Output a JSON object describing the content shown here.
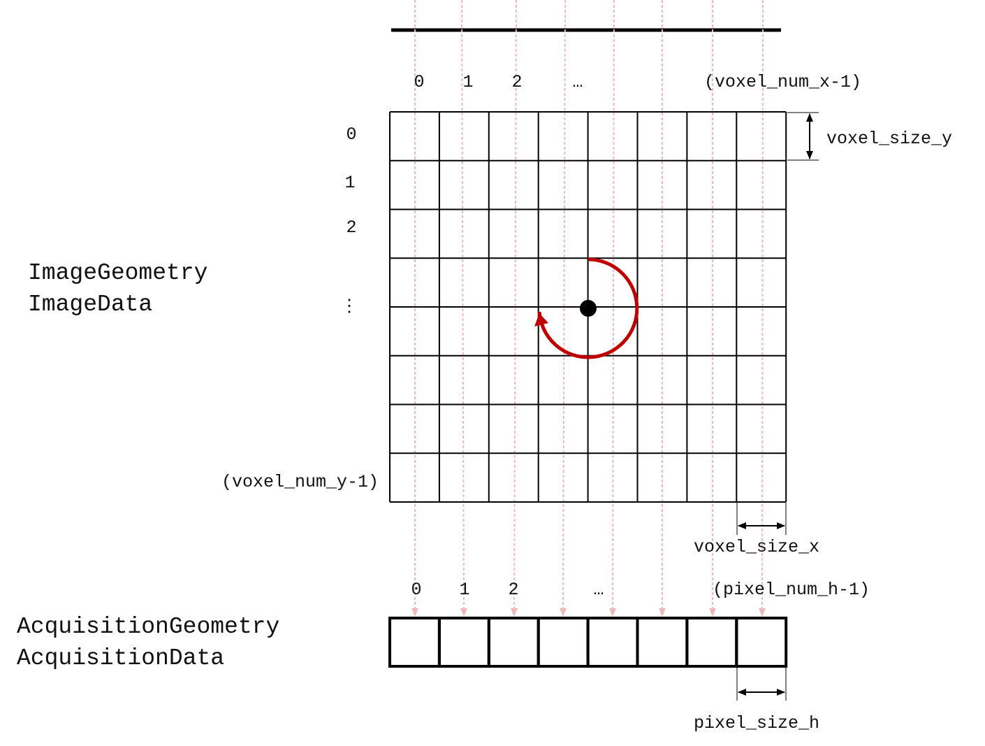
{
  "image_block": {
    "name_line1": "ImageGeometry",
    "name_line2": "ImageData"
  },
  "acquisition_block": {
    "name_line1": "AcquisitionGeometry",
    "name_line2": "AcquisitionData"
  },
  "voxel_grid": {
    "columns": 8,
    "rows": 8,
    "x_index_labels": [
      "0",
      "1",
      "2",
      "…",
      "(voxel_num_x-1)"
    ],
    "y_index_labels": [
      "0",
      "1",
      "2",
      "⋮",
      "(voxel_num_y-1)"
    ],
    "size_y_label": "voxel_size_y",
    "size_x_label": "voxel_size_x",
    "rotation_color": "#c00000"
  },
  "detector": {
    "pixels": 8,
    "h_index_labels": [
      "0",
      "1",
      "2",
      "…",
      "(pixel_num_h-1)"
    ],
    "size_h_label": "pixel_size_h"
  },
  "rays": {
    "count": 8,
    "color": "#f0b8b8"
  },
  "source_bar_color": "#000000"
}
